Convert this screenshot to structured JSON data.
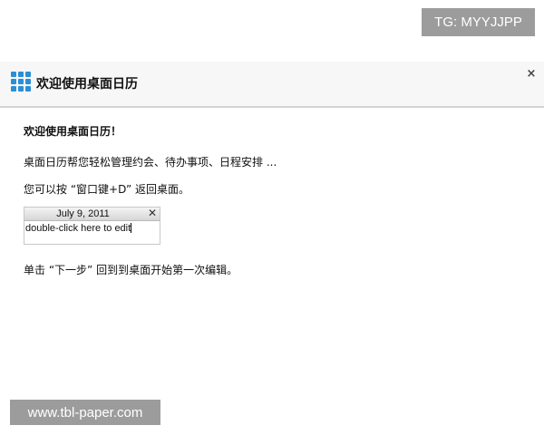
{
  "watermarks": {
    "top": "TG: MYYJJPP",
    "bottom": "www.tbl-paper.com"
  },
  "window": {
    "title": "欢迎使用桌面日历",
    "close_label": "×",
    "icon": "calendar-grid-icon",
    "accent_color": "#2a8fd6"
  },
  "content": {
    "heading": "欢迎使用桌面日历！",
    "line1": "桌面日历帮您轻松管理约会、待办事项、日程安排 ...",
    "line2": "您可以按 “窗口键+D” 返回桌面。",
    "line3": "单击 “下一步” 回到到桌面开始第一次编辑。"
  },
  "widget": {
    "date": "July 9, 2011",
    "close_label": "✕",
    "text": "double-click here to edit"
  }
}
